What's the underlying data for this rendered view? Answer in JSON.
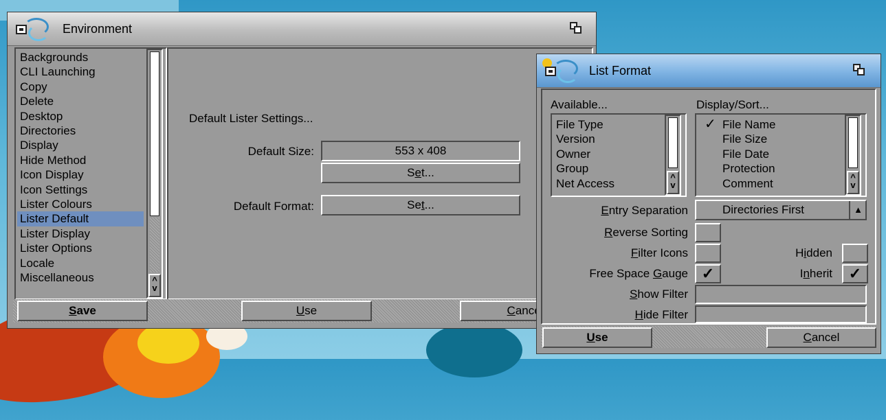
{
  "env": {
    "title": "Environment",
    "items": [
      "Backgrounds",
      "CLI Launching",
      "Copy",
      "Delete",
      "Desktop",
      "Directories",
      "Display",
      "Hide Method",
      "Icon Display",
      "Icon Settings",
      "Lister Colours",
      "Lister Default",
      "Lister Display",
      "Lister Options",
      "Locale",
      "Miscellaneous"
    ],
    "selected_index": 11,
    "section_heading": "Default Lister Settings...",
    "default_size_label": "Default Size:",
    "default_size_value": "553 x 408",
    "set_label": "Set...",
    "default_format_label": "Default Format:",
    "save_label": "Save",
    "use_label": "Use",
    "cancel_label": "Cancel"
  },
  "lf": {
    "title": "List Format",
    "available_header": "Available...",
    "available_items": [
      "File Type",
      "Version",
      "Owner",
      "Group",
      "Net Access"
    ],
    "display_header": "Display/Sort...",
    "display_items": [
      {
        "label": "File Name",
        "checked": true
      },
      {
        "label": "File Size",
        "checked": false
      },
      {
        "label": "File Date",
        "checked": false
      },
      {
        "label": "Protection",
        "checked": false
      },
      {
        "label": "Comment",
        "checked": false
      }
    ],
    "entry_separation_label": "Entry Separation",
    "entry_separation_value": "Directories First",
    "reverse_sorting_label": "Reverse Sorting",
    "reverse_sorting_checked": false,
    "filter_icons_label": "Filter Icons",
    "filter_icons_checked": false,
    "hidden_label": "Hidden",
    "hidden_checked": false,
    "free_space_label": "Free Space Gauge",
    "free_space_checked": true,
    "inherit_label": "Inherit",
    "inherit_checked": true,
    "show_filter_label": "Show Filter",
    "show_filter_value": "",
    "hide_filter_label": "Hide Filter",
    "hide_filter_value": "",
    "use_label": "Use",
    "cancel_label": "Cancel"
  }
}
